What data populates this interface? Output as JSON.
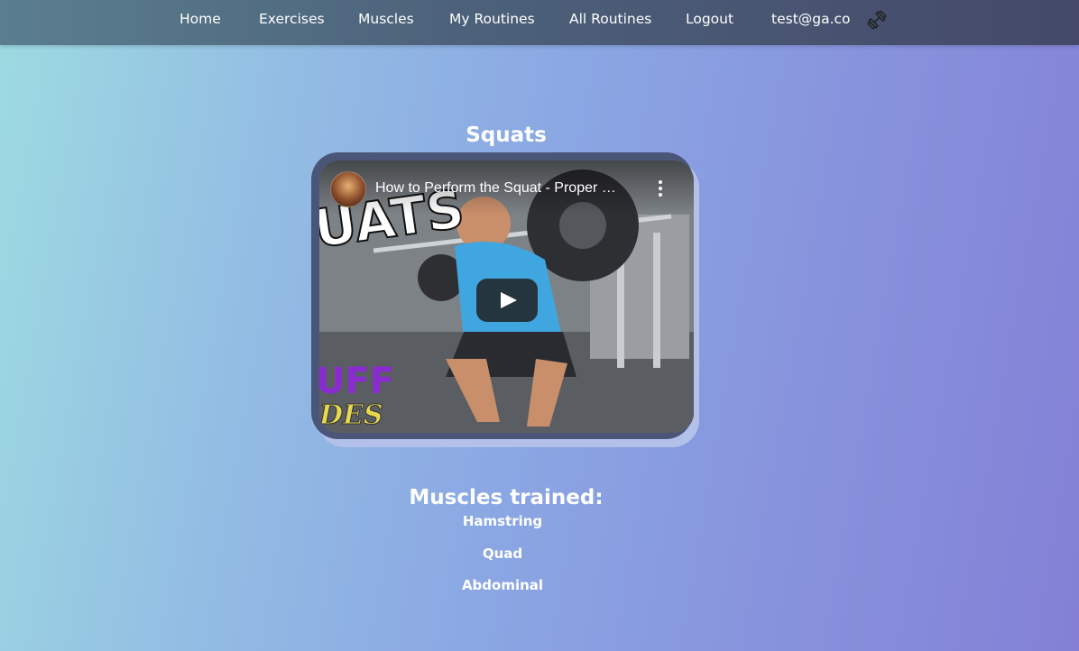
{
  "nav": {
    "links": [
      {
        "label": "Home"
      },
      {
        "label": "Exercises"
      },
      {
        "label": "Muscles"
      },
      {
        "label": "My Routines"
      },
      {
        "label": "All Routines"
      },
      {
        "label": "Logout"
      },
      {
        "label": "test@ga.co"
      }
    ],
    "icon": "dumbbell-icon"
  },
  "exercise": {
    "title": "Squats",
    "video": {
      "title": "How to Perform the Squat - Proper …",
      "play_icon": "play-icon",
      "menu_icon": "more-vertical-icon"
    }
  },
  "muscles": {
    "heading": "Muscles trained:",
    "items": [
      "Hamstring",
      "Quad",
      "Abdominal"
    ]
  },
  "colors": {
    "navbar": "#4c6079",
    "video_frame": "#4a5578",
    "frame_shadow": "#b3c0ea",
    "text": "#ffffff"
  }
}
